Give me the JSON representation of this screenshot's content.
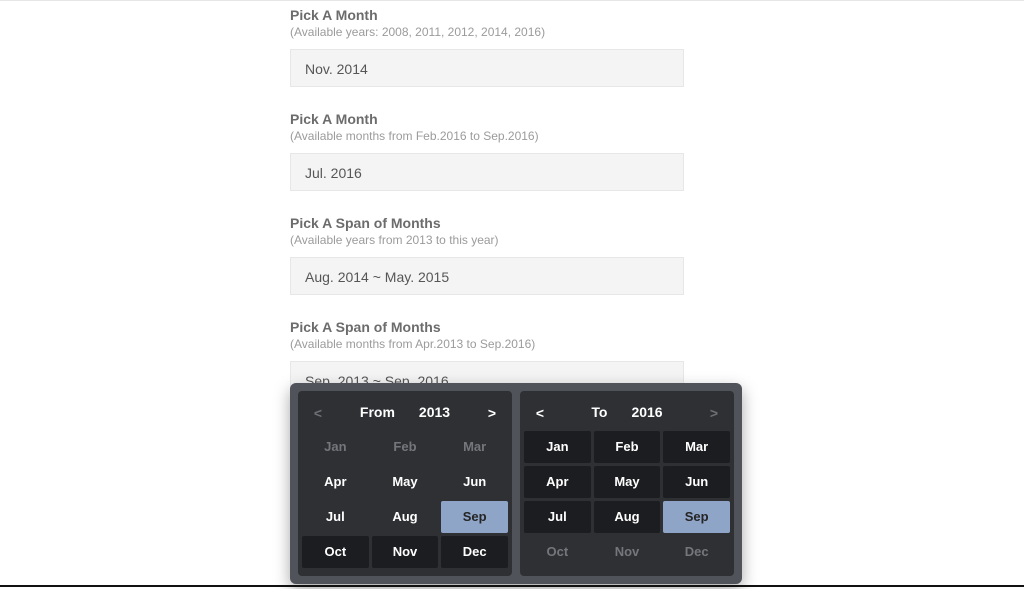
{
  "groups": [
    {
      "label": "Pick A Month",
      "hint": "(Available years: 2008, 2011, 2012, 2014, 2016)",
      "value": "Nov. 2014"
    },
    {
      "label": "Pick A Month",
      "hint": "(Available months from Feb.2016 to Sep.2016)",
      "value": "Jul. 2016"
    },
    {
      "label": "Pick A Span of Months",
      "hint": "(Available years from 2013 to this year)",
      "value": "Aug. 2014 ~ May. 2015"
    },
    {
      "label": "Pick A Span of Months",
      "hint": "(Available months from Apr.2013 to Sep.2016)",
      "value": "Sep. 2013 ~ Sep. 2016"
    }
  ],
  "picker": {
    "from": {
      "title": "From",
      "year": "2013",
      "prev": {
        "glyph": "<",
        "enabled": false
      },
      "next": {
        "glyph": ">",
        "enabled": true
      },
      "months": [
        {
          "abbr": "Jan",
          "enabled": false,
          "selected": false,
          "dark": false
        },
        {
          "abbr": "Feb",
          "enabled": false,
          "selected": false,
          "dark": false
        },
        {
          "abbr": "Mar",
          "enabled": false,
          "selected": false,
          "dark": false
        },
        {
          "abbr": "Apr",
          "enabled": true,
          "selected": false,
          "dark": false
        },
        {
          "abbr": "May",
          "enabled": true,
          "selected": false,
          "dark": false
        },
        {
          "abbr": "Jun",
          "enabled": true,
          "selected": false,
          "dark": false
        },
        {
          "abbr": "Jul",
          "enabled": true,
          "selected": false,
          "dark": false
        },
        {
          "abbr": "Aug",
          "enabled": true,
          "selected": false,
          "dark": false
        },
        {
          "abbr": "Sep",
          "enabled": true,
          "selected": true,
          "dark": false
        },
        {
          "abbr": "Oct",
          "enabled": true,
          "selected": false,
          "dark": true
        },
        {
          "abbr": "Nov",
          "enabled": true,
          "selected": false,
          "dark": true
        },
        {
          "abbr": "Dec",
          "enabled": true,
          "selected": false,
          "dark": true
        }
      ]
    },
    "to": {
      "title": "To",
      "year": "2016",
      "prev": {
        "glyph": "<",
        "enabled": true
      },
      "next": {
        "glyph": ">",
        "enabled": false
      },
      "months": [
        {
          "abbr": "Jan",
          "enabled": true,
          "selected": false,
          "dark": true
        },
        {
          "abbr": "Feb",
          "enabled": true,
          "selected": false,
          "dark": true
        },
        {
          "abbr": "Mar",
          "enabled": true,
          "selected": false,
          "dark": true
        },
        {
          "abbr": "Apr",
          "enabled": true,
          "selected": false,
          "dark": true
        },
        {
          "abbr": "May",
          "enabled": true,
          "selected": false,
          "dark": true
        },
        {
          "abbr": "Jun",
          "enabled": true,
          "selected": false,
          "dark": true
        },
        {
          "abbr": "Jul",
          "enabled": true,
          "selected": false,
          "dark": true
        },
        {
          "abbr": "Aug",
          "enabled": true,
          "selected": false,
          "dark": true
        },
        {
          "abbr": "Sep",
          "enabled": true,
          "selected": true,
          "dark": false
        },
        {
          "abbr": "Oct",
          "enabled": false,
          "selected": false,
          "dark": false
        },
        {
          "abbr": "Nov",
          "enabled": false,
          "selected": false,
          "dark": false
        },
        {
          "abbr": "Dec",
          "enabled": false,
          "selected": false,
          "dark": false
        }
      ]
    }
  }
}
